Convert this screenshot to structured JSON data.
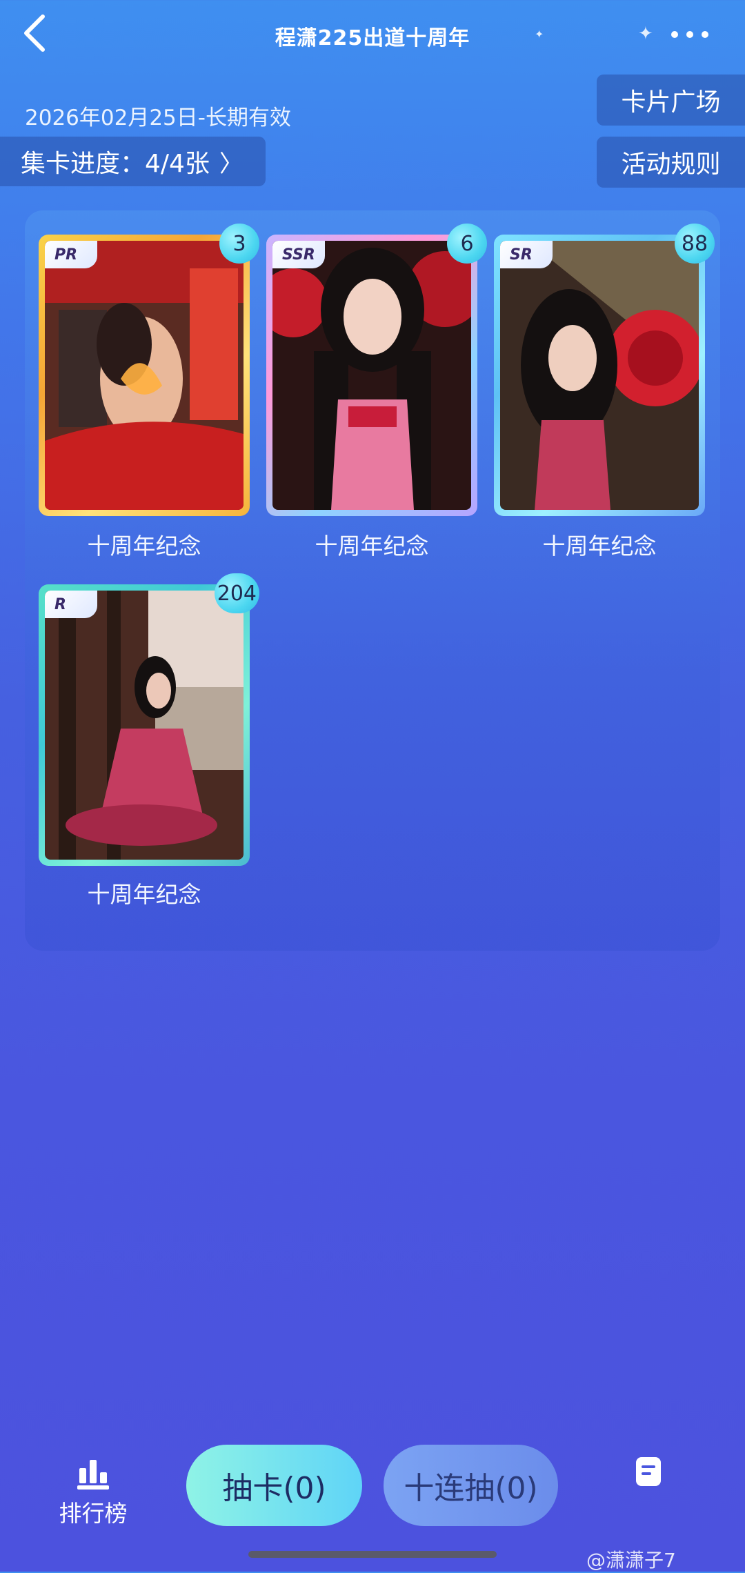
{
  "header": {
    "title": "程潇225出道十周年",
    "back_icon": "chevron-left-icon",
    "more_icon": "more-dots-icon"
  },
  "validity": "2026年02月25日-长期有效",
  "buttons": {
    "square": "卡片广场",
    "rules": "活动规则",
    "progress": "集卡进度：4/4张"
  },
  "cards": [
    {
      "rarity": "PR",
      "count": "3",
      "label": "十周年纪念"
    },
    {
      "rarity": "SSR",
      "count": "6",
      "label": "十周年纪念"
    },
    {
      "rarity": "SR",
      "count": "88",
      "label": "十周年纪念"
    },
    {
      "rarity": "R",
      "count": "204",
      "label": "十周年纪念"
    }
  ],
  "bottom": {
    "rank_label": "排行榜",
    "draw_label": "抽卡(0)",
    "draw10_label": "十连抽(0)",
    "doc_icon": "document-icon"
  },
  "watermark": "@潇潇子7",
  "colors": {
    "pr": "#f5b43c",
    "ssr": "#ff9ad9",
    "sr": "#5ec2f5",
    "r": "#3fc9d6",
    "primary_button": "#5fd4f7"
  }
}
